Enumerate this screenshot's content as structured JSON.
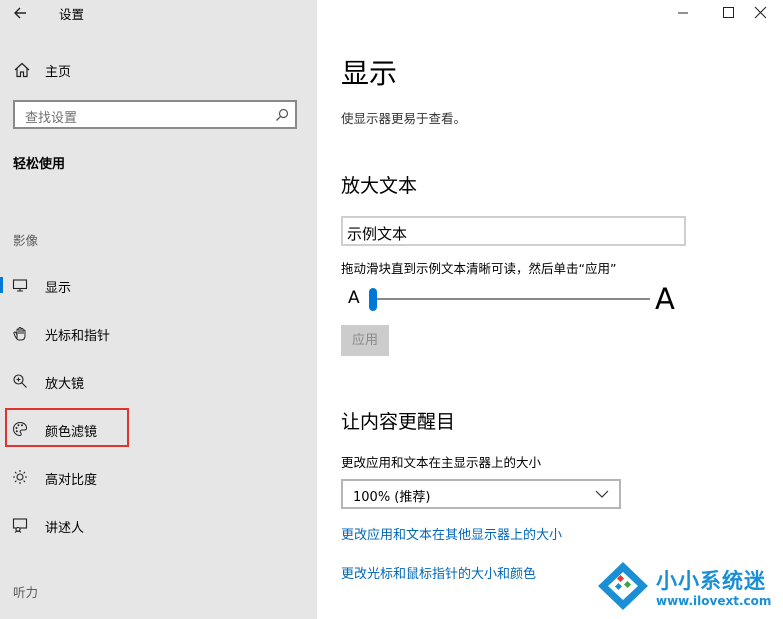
{
  "window": {
    "title": "设置"
  },
  "sidebar": {
    "home_label": "主页",
    "search_placeholder": "查找设置",
    "section_title": "轻松使用",
    "groups": {
      "vision": "影像",
      "hearing": "听力"
    },
    "items": [
      {
        "label": "显示",
        "icon": "display-icon",
        "active": true
      },
      {
        "label": "光标和指针",
        "icon": "pointer-icon",
        "active": false
      },
      {
        "label": "放大镜",
        "icon": "magnifier-icon",
        "active": false
      },
      {
        "label": "颜色滤镜",
        "icon": "palette-icon",
        "active": false
      },
      {
        "label": "高对比度",
        "icon": "contrast-icon",
        "active": false
      },
      {
        "label": "讲述人",
        "icon": "narrator-icon",
        "active": false
      }
    ]
  },
  "main": {
    "title": "显示",
    "subtitle": "使显示器更易于查看。",
    "enlarge": {
      "heading": "放大文本",
      "sample_text": "示例文本",
      "hint": "拖动滑块直到示例文本清晰可读，然后单击“应用”",
      "small_a": "A",
      "large_a": "A",
      "slider_value_fraction": 0.0,
      "apply_label": "应用"
    },
    "bigger": {
      "heading": "让内容更醒目",
      "size_label": "更改应用和文本在主显示器上的大小",
      "size_value": "100% (推荐)",
      "link_other_displays": "更改应用和文本在其他显示器上的大小",
      "link_cursor": "更改光标和鼠标指针的大小和颜色"
    }
  },
  "watermark": {
    "title": "小小系统迷",
    "url": "www.ilovext.com"
  },
  "colors": {
    "accent": "#0078d7",
    "link": "#0067b8",
    "highlight": "#e0322f",
    "sidebar_bg": "#e6e6e6"
  }
}
